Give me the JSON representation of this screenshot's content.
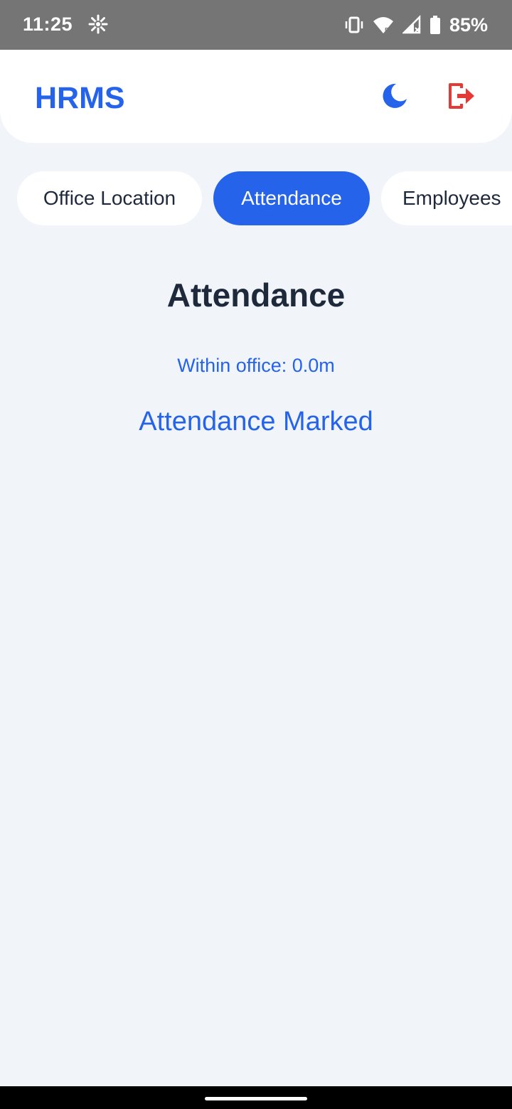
{
  "status_bar": {
    "time": "11:25",
    "battery": "85%",
    "icons": [
      "settings-sparkle-icon",
      "vibrate-icon",
      "wifi-icon",
      "signal-icon",
      "battery-icon"
    ]
  },
  "header": {
    "title": "HRMS",
    "theme_icon": "moon-icon",
    "logout_icon": "logout-icon",
    "accent_color": "#2563eb",
    "logout_color": "#e53935"
  },
  "tabs": [
    {
      "label": "Office Location",
      "active": false
    },
    {
      "label": "Attendance",
      "active": true
    },
    {
      "label": "Employees",
      "active": false
    }
  ],
  "content": {
    "title": "Attendance",
    "distance": "Within office: 0.0m",
    "status": "Attendance Marked"
  }
}
